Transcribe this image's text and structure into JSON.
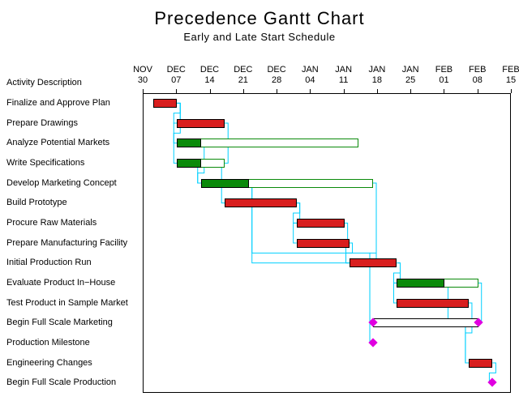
{
  "title": "Precedence Gantt Chart",
  "subtitle": "Early and Late Start Schedule",
  "yaxis_title": "Activity Description",
  "chart_data": {
    "type": "bar",
    "orientation": "gantt",
    "x_ticks": [
      {
        "label_top": "NOV",
        "label_bot": "30",
        "value": 0
      },
      {
        "label_top": "DEC",
        "label_bot": "07",
        "value": 7
      },
      {
        "label_top": "DEC",
        "label_bot": "14",
        "value": 14
      },
      {
        "label_top": "DEC",
        "label_bot": "21",
        "value": 21
      },
      {
        "label_top": "DEC",
        "label_bot": "28",
        "value": 28
      },
      {
        "label_top": "JAN",
        "label_bot": "04",
        "value": 35
      },
      {
        "label_top": "JAN",
        "label_bot": "11",
        "value": 42
      },
      {
        "label_top": "JAN",
        "label_bot": "18",
        "value": 49
      },
      {
        "label_top": "JAN",
        "label_bot": "25",
        "value": 56
      },
      {
        "label_top": "FEB",
        "label_bot": "01",
        "value": 63
      },
      {
        "label_top": "FEB",
        "label_bot": "08",
        "value": 70
      },
      {
        "label_top": "FEB",
        "label_bot": "15",
        "value": 77
      }
    ],
    "xlim": [
      0,
      77
    ],
    "rows": [
      {
        "label": "Finalize and Approve Plan",
        "bars": [
          {
            "start": 2,
            "end": 7,
            "color": "red"
          }
        ]
      },
      {
        "label": "Prepare Drawings",
        "bars": [
          {
            "start": 7,
            "end": 17,
            "color": "red"
          }
        ]
      },
      {
        "label": "Analyze Potential Markets",
        "bars": [
          {
            "start": 7,
            "end": 45,
            "color": "hollow-green"
          },
          {
            "start": 7,
            "end": 12,
            "color": "green"
          }
        ]
      },
      {
        "label": "Write Specifications",
        "bars": [
          {
            "start": 7,
            "end": 17,
            "color": "hollow-green"
          },
          {
            "start": 7,
            "end": 12,
            "color": "green"
          }
        ]
      },
      {
        "label": "Develop Marketing Concept",
        "bars": [
          {
            "start": 12,
            "end": 48,
            "color": "hollow-green"
          },
          {
            "start": 12,
            "end": 22,
            "color": "green"
          }
        ]
      },
      {
        "label": "Build Prototype",
        "bars": [
          {
            "start": 17,
            "end": 32,
            "color": "red"
          }
        ]
      },
      {
        "label": "Procure Raw Materials",
        "bars": [
          {
            "start": 32,
            "end": 42,
            "color": "red"
          }
        ]
      },
      {
        "label": "Prepare Manufacturing Facility",
        "bars": [
          {
            "start": 32,
            "end": 43,
            "color": "red"
          }
        ]
      },
      {
        "label": "Initial Production Run",
        "bars": [
          {
            "start": 43,
            "end": 53,
            "color": "red"
          }
        ]
      },
      {
        "label": "Evaluate Product In−House",
        "bars": [
          {
            "start": 53,
            "end": 70,
            "color": "hollow-green"
          },
          {
            "start": 53,
            "end": 63,
            "color": "green"
          }
        ]
      },
      {
        "label": "Test Product in Sample Market",
        "bars": [
          {
            "start": 53,
            "end": 68,
            "color": "red"
          }
        ]
      },
      {
        "label": "Begin Full Scale Marketing",
        "bars": [
          {
            "start": 48,
            "end": 70,
            "color": "hollow-black"
          }
        ],
        "milestones": [
          48,
          70
        ]
      },
      {
        "label": "Production Milestone",
        "milestones": [
          48
        ]
      },
      {
        "label": "Engineering Changes",
        "bars": [
          {
            "start": 68,
            "end": 73,
            "color": "red"
          }
        ]
      },
      {
        "label": "Begin Full Scale Production",
        "milestones": [
          73
        ]
      }
    ],
    "dependencies": [
      {
        "from_row": 0,
        "from_x": 7,
        "to_row": 1,
        "to_x": 7
      },
      {
        "from_row": 0,
        "from_x": 7,
        "to_row": 2,
        "to_x": 7
      },
      {
        "from_row": 0,
        "from_x": 7,
        "to_row": 3,
        "to_x": 7
      },
      {
        "from_row": 2,
        "from_x": 12,
        "to_row": 4,
        "to_x": 12
      },
      {
        "from_row": 3,
        "from_x": 12,
        "to_row": 4,
        "to_x": 12
      },
      {
        "from_row": 1,
        "from_x": 17,
        "to_row": 5,
        "to_x": 17
      },
      {
        "from_row": 5,
        "from_x": 32,
        "to_row": 6,
        "to_x": 32
      },
      {
        "from_row": 5,
        "from_x": 32,
        "to_row": 7,
        "to_x": 32
      },
      {
        "from_row": 6,
        "from_x": 42,
        "to_row": 8,
        "to_x": 43
      },
      {
        "from_row": 7,
        "from_x": 43,
        "to_row": 8,
        "to_x": 43
      },
      {
        "from_row": 8,
        "from_x": 53,
        "to_row": 9,
        "to_x": 53
      },
      {
        "from_row": 8,
        "from_x": 53,
        "to_row": 10,
        "to_x": 53
      },
      {
        "from_row": 4,
        "from_x": 22,
        "to_row": 11,
        "to_x": 48,
        "late_from_x": 48
      },
      {
        "from_row": 4,
        "from_x": 22,
        "to_row": 12,
        "to_x": 48,
        "late_from_x": 48
      },
      {
        "from_row": 9,
        "from_x": 63,
        "to_row": 13,
        "to_x": 68,
        "late_from_x": 70
      },
      {
        "from_row": 10,
        "from_x": 68,
        "to_row": 13,
        "to_x": 68
      },
      {
        "from_row": 13,
        "from_x": 73,
        "to_row": 14,
        "to_x": 73
      }
    ]
  }
}
